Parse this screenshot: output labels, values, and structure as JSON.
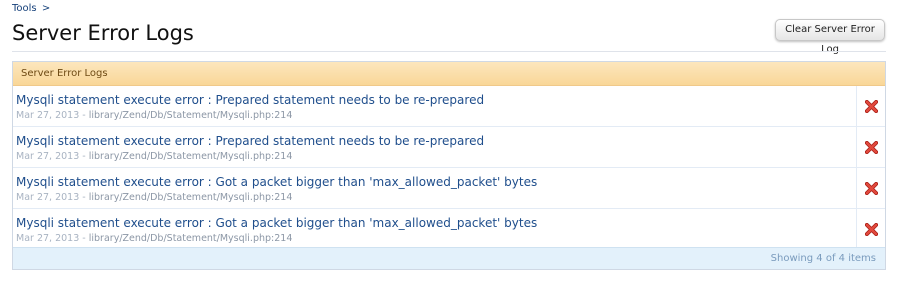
{
  "breadcrumb": {
    "items": [
      "Tools"
    ],
    "separator": ">"
  },
  "page": {
    "title": "Server Error Logs"
  },
  "toolbar": {
    "clear_label": "Clear Server Error Log"
  },
  "list": {
    "header": "Server Error Logs",
    "rows": [
      {
        "message": "Mysqli statement execute error : Prepared statement needs to be re-prepared",
        "date": "Mar 27, 2013",
        "dash": "-",
        "path": "library/Zend/Db/Statement/Mysqli.php:214"
      },
      {
        "message": "Mysqli statement execute error : Prepared statement needs to be re-prepared",
        "date": "Mar 27, 2013",
        "dash": "-",
        "path": "library/Zend/Db/Statement/Mysqli.php:214"
      },
      {
        "message": "Mysqli statement execute error : Got a packet bigger than 'max_allowed_packet' bytes",
        "date": "Mar 27, 2013",
        "dash": "-",
        "path": "library/Zend/Db/Statement/Mysqli.php:214"
      },
      {
        "message": "Mysqli statement execute error : Got a packet bigger than 'max_allowed_packet' bytes",
        "date": "Mar 27, 2013",
        "dash": "-",
        "path": "library/Zend/Db/Statement/Mysqli.php:214"
      }
    ],
    "footer": "Showing 4 of 4 items"
  },
  "icons": {
    "delete": "delete-x-icon"
  },
  "colors": {
    "link": "#1f4e8c",
    "header_bg": "#fbdfa9",
    "footer_bg": "#e3f1fb",
    "delete_red": "#d9362b"
  }
}
